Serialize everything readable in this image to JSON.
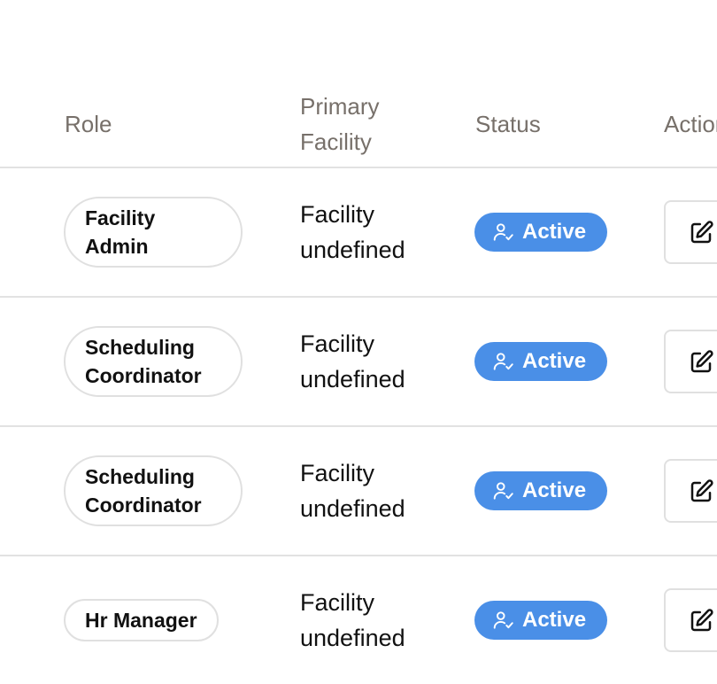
{
  "table": {
    "headers": {
      "role": "Role",
      "primary_facility": "Primary Facility",
      "status": "Status",
      "actions": "Actions"
    },
    "rows": [
      {
        "role": "Facility Admin",
        "facility": "Facility undefined",
        "status": "Active"
      },
      {
        "role": "Scheduling Coordinator",
        "facility": "Facility undefined",
        "status": "Active"
      },
      {
        "role": "Scheduling Coordinator",
        "facility": "Facility undefined",
        "status": "Active"
      },
      {
        "role": "Hr Manager",
        "facility": "Facility undefined",
        "status": "Active"
      }
    ]
  },
  "icons": {
    "status": "user-check-icon",
    "edit": "edit-icon"
  },
  "colors": {
    "status_active": "#4a8fe7",
    "header_text": "#77706a",
    "divider": "#e2e2e2"
  }
}
